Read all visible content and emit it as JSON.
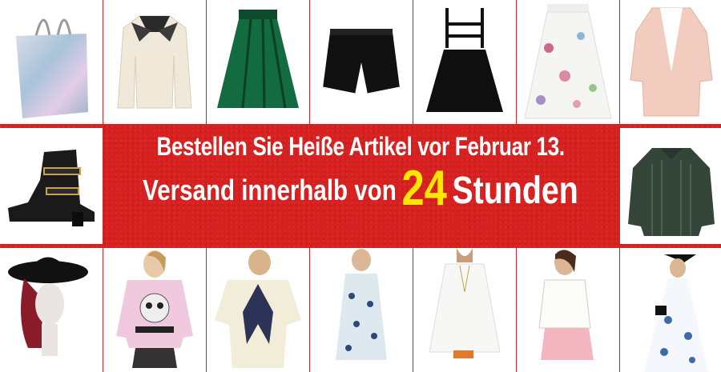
{
  "headline": {
    "line1": "Bestellen Sie Heiße Artikel vor Februar 13.",
    "line2_prefix": "Versand innerhalb von",
    "line2_number": "24",
    "line2_suffix": "Stunden"
  },
  "colors": {
    "background": "#d7201f",
    "text": "#ffffff",
    "highlight": "#ffe600"
  },
  "products": [
    "holographic-tote-bag",
    "cream-fur-jacket",
    "green-satin-skirt",
    "black-shorts",
    "black-suspender-skirt",
    "floral-midi-skirt",
    "beige-drape-cardigan",
    "black-buckle-boots",
    "green-striped-shirt",
    "black-floppy-hat",
    "chanel-skull-sweatshirt",
    "wing-print-tee",
    "eye-print-dress",
    "white-slit-dress",
    "lace-top-pink-skirt",
    "floral-maxi-dress"
  ]
}
